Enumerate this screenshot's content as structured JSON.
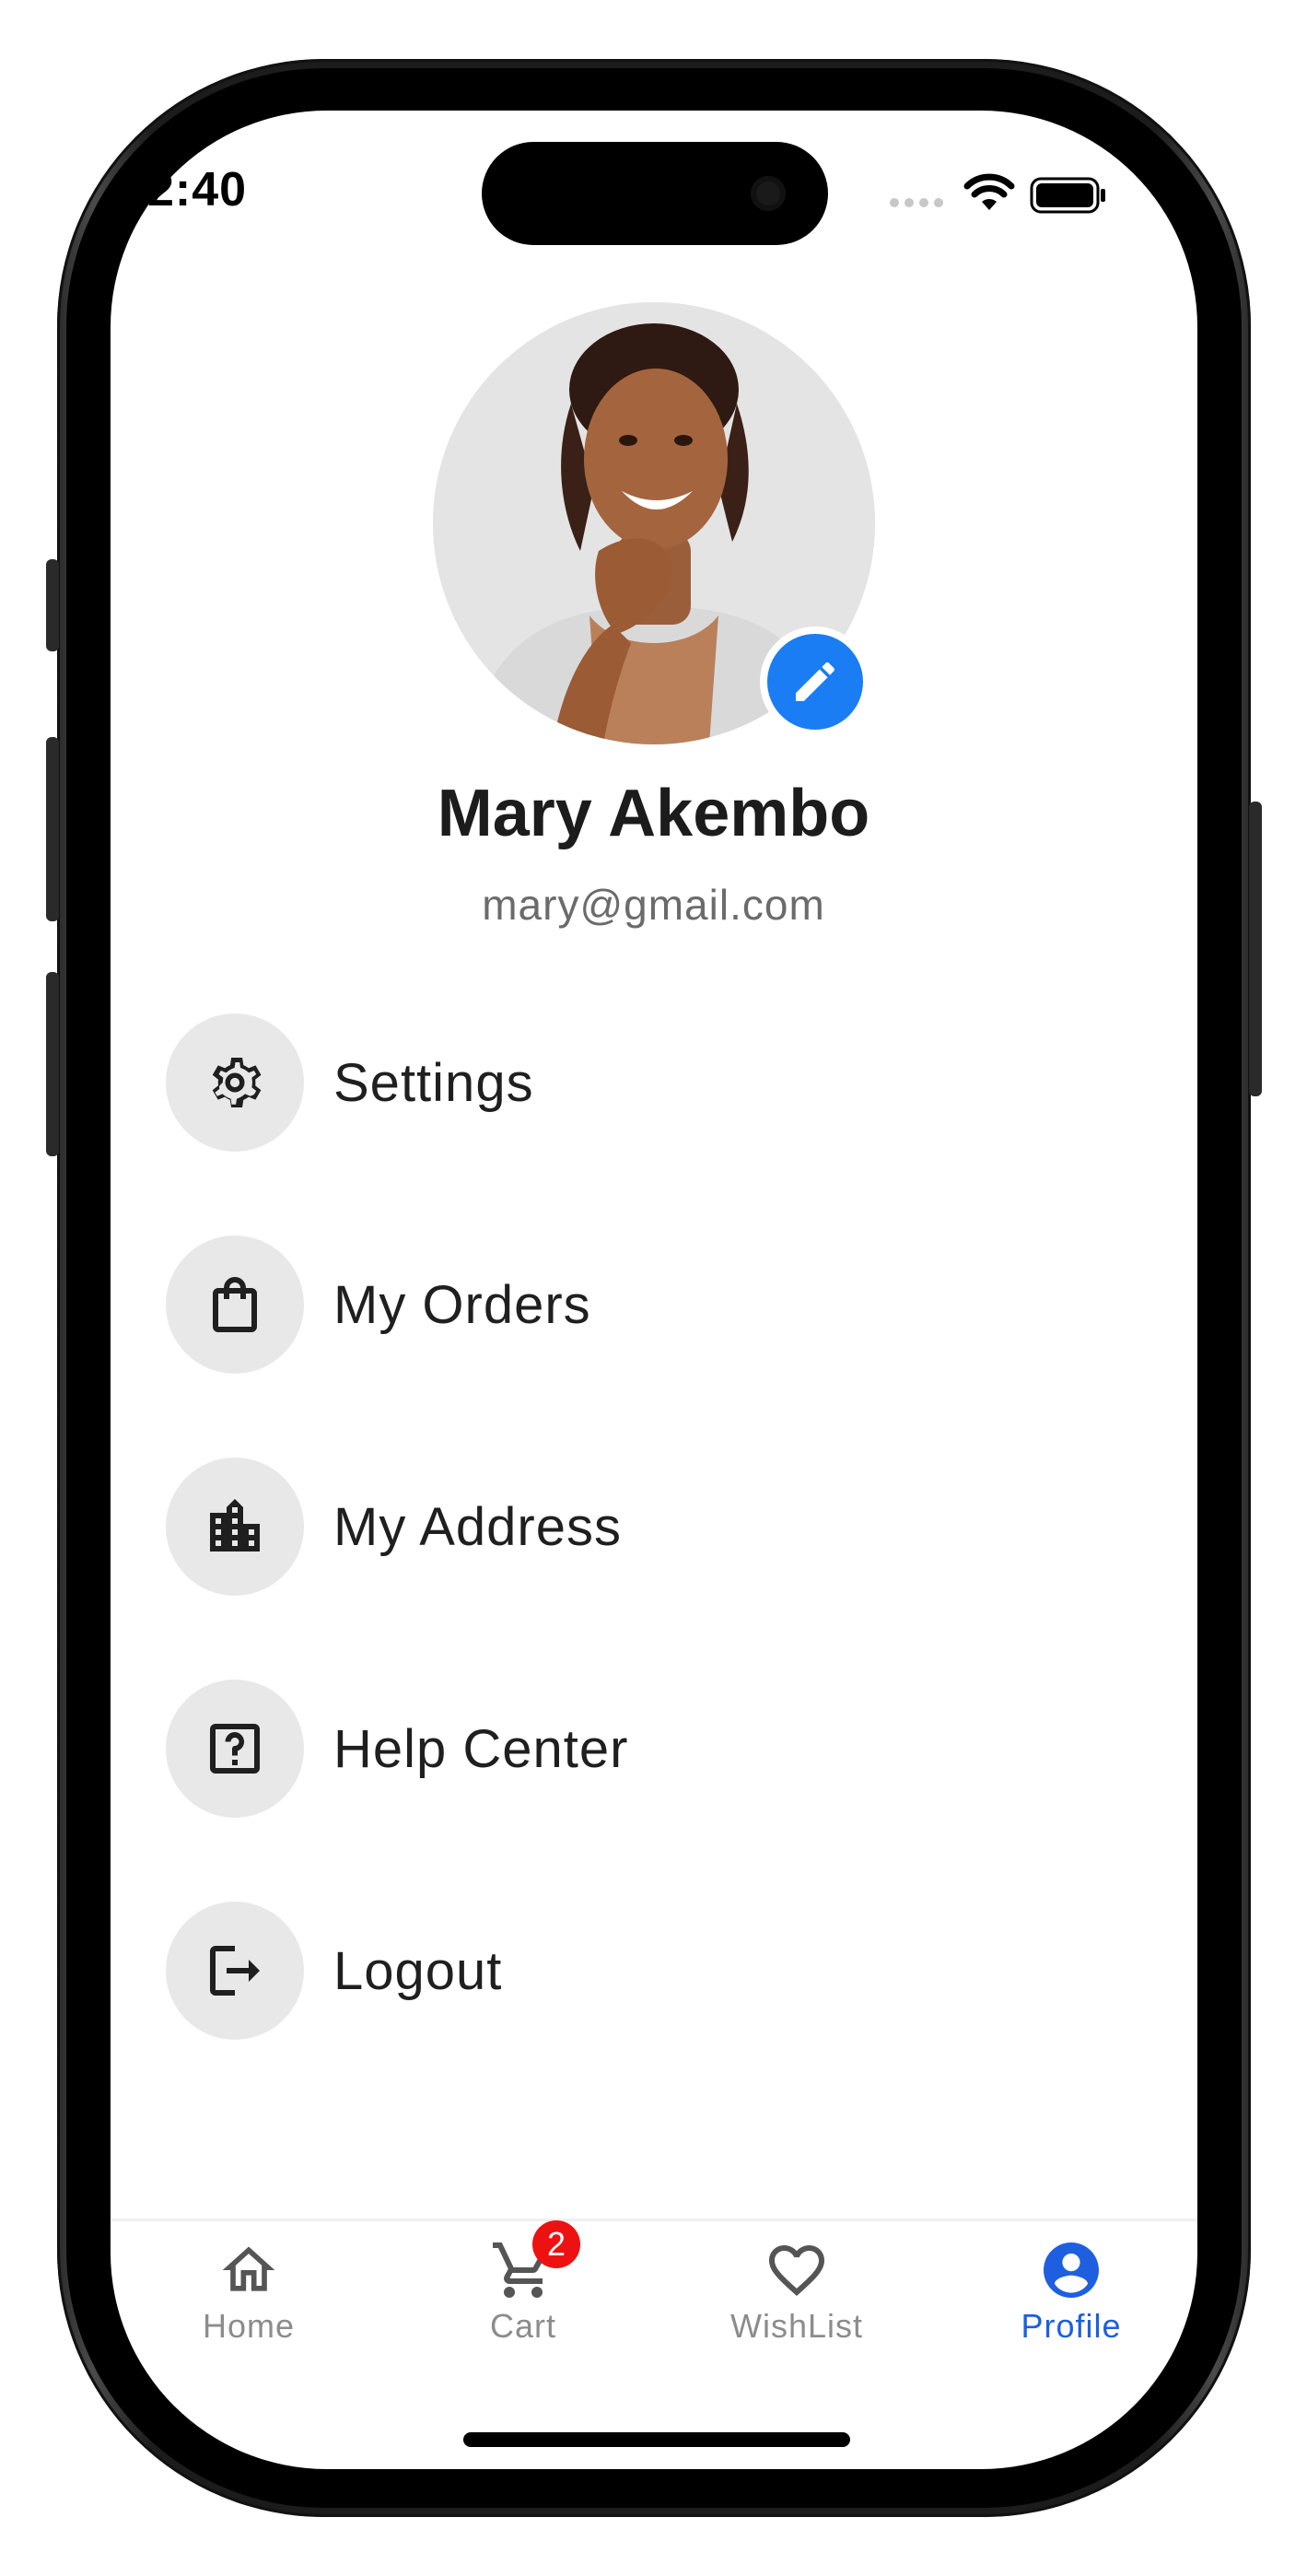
{
  "status_bar": {
    "time": "2:40"
  },
  "profile": {
    "name": "Mary Akembo",
    "email": "mary@gmail.com",
    "avatar_icon": "user-photo",
    "edit_icon": "pencil-icon",
    "edit_color": "#1a7df4"
  },
  "menu": {
    "items": [
      {
        "label": "Settings",
        "icon": "gear-icon"
      },
      {
        "label": "My Orders",
        "icon": "shopping-bag-icon"
      },
      {
        "label": "My Address",
        "icon": "buildings-icon"
      },
      {
        "label": "Help Center",
        "icon": "question-box-icon"
      },
      {
        "label": "Logout",
        "icon": "logout-icon"
      }
    ]
  },
  "bottom_nav": {
    "items": [
      {
        "label": "Home",
        "icon": "home-icon",
        "active": false
      },
      {
        "label": "Cart",
        "icon": "cart-icon",
        "active": false,
        "badge": "2"
      },
      {
        "label": "WishList",
        "icon": "heart-icon",
        "active": false
      },
      {
        "label": "Profile",
        "icon": "account-circle-icon",
        "active": true
      }
    ],
    "active_color": "#1e5fe0",
    "badge_color": "#ee1111"
  }
}
